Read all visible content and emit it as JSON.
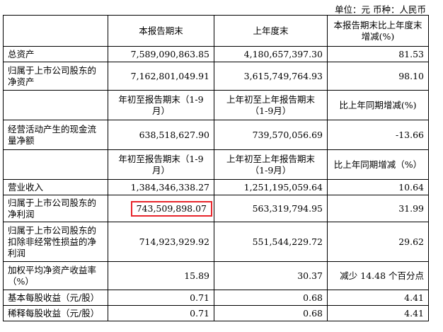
{
  "unit_line": "单位：元    币种：人民币",
  "header1": [
    "本报告期末",
    "上年度末",
    "本报告期末比上年度末增减(%)"
  ],
  "rows_balance": [
    {
      "label": "总资产",
      "v": [
        "7,589,090,863.85",
        "4,180,657,397.30",
        "81.53"
      ]
    },
    {
      "label": "归属于上市公司股东的净资产",
      "v": [
        "7,162,801,049.91",
        "3,615,749,764.93",
        "98.10"
      ]
    }
  ],
  "header2": [
    "年初至报告期末（1-9月）",
    "上年初至上年报告期末（1-9月）",
    "比上年同期增减(%)"
  ],
  "rows_cash": [
    {
      "label": "经营活动产生的现金流量净额",
      "v": [
        "638,518,627.90",
        "739,570,056.69",
        "-13.66"
      ]
    }
  ],
  "header3": [
    "年初至报告期末（1-9月）",
    "上年初至上年报告期末（1-9月）",
    "比上年同期增减（%）"
  ],
  "rows_income": [
    {
      "label": "营业收入",
      "v": [
        "1,384,346,338.27",
        "1,251,195,059.64",
        "10.64"
      ]
    },
    {
      "label": "归属于上市公司股东的净利润",
      "v": [
        "743,509,898.07",
        "563,319,794.95",
        "31.99"
      ]
    },
    {
      "label": "归属于上市公司股东的扣除非经常性损益的净利润",
      "v": [
        "714,923,929.92",
        "551,544,229.72",
        "29.62"
      ]
    },
    {
      "label": "加权平均净资产收益率（%）",
      "v": [
        "15.89",
        "30.37",
        "减少 14.48 个百分点"
      ]
    },
    {
      "label": "基本每股收益（元/股）",
      "v": [
        "0.71",
        "0.68",
        "4.41"
      ]
    },
    {
      "label": "稀释每股收益（元/股）",
      "v": [
        "0.71",
        "0.68",
        "4.41"
      ]
    }
  ]
}
